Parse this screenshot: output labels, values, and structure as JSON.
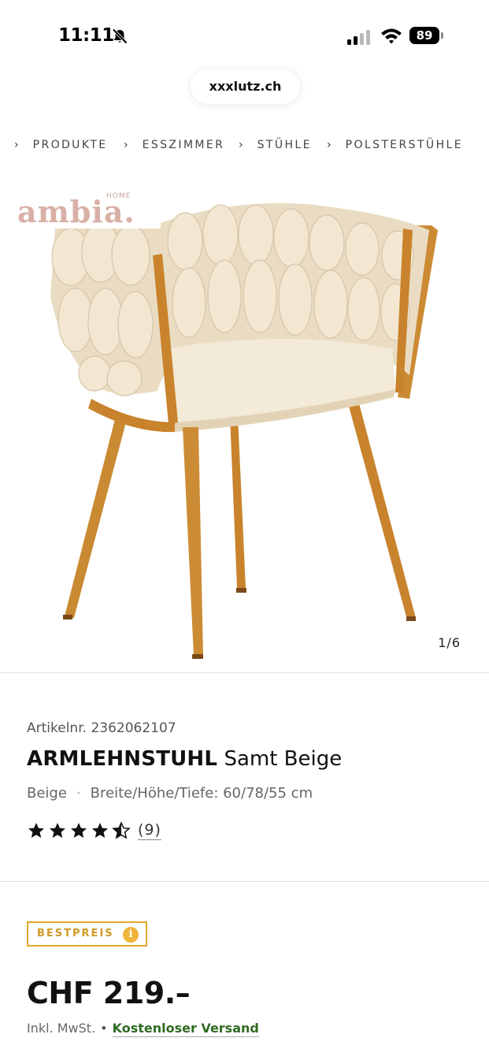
{
  "status_bar": {
    "time": "11:11",
    "battery": "89"
  },
  "browser": {
    "url": "xxxlutz.ch"
  },
  "breadcrumb": [
    {
      "label": "PRODUKTE"
    },
    {
      "label": "ESSZIMMER"
    },
    {
      "label": "STÜHLE"
    },
    {
      "label": "POLSTERSTÜHLE"
    }
  ],
  "gallery": {
    "brand_logo": {
      "word": "ambia.",
      "superscript": "HOME"
    },
    "counter": "1/6"
  },
  "product": {
    "article_number": "Artikelnr. 2362062107",
    "title_bold": "ARMLEHNSTUHL",
    "title_rest": "Samt Beige",
    "color": "Beige",
    "dimensions": "Breite/Höhe/Tiefe: 60/78/55 cm",
    "rating": 4.5,
    "rating_max": 5,
    "review_count": "(9)"
  },
  "pricing": {
    "badge_label": "BESTPREIS",
    "badge_icon": "i",
    "price": "CHF 219.–",
    "tax_note": "Inkl. MwSt.",
    "separator": "•",
    "shipping_note": "Kostenloser Versand"
  },
  "colors": {
    "badge_accent": "#e3a92b",
    "shipping_green": "#2f6b22",
    "brand_pink": "#d9b0a6"
  }
}
